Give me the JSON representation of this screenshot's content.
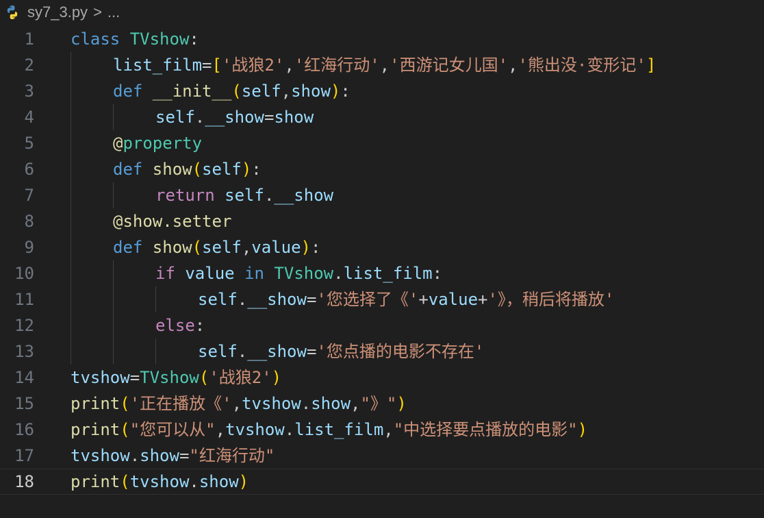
{
  "breadcrumb": {
    "file": "sy7_3.py",
    "separator": ">",
    "more": "..."
  },
  "lines": [
    {
      "n": "1",
      "indent": 0,
      "tokens": [
        {
          "t": "class ",
          "c": "kw"
        },
        {
          "t": "TVshow",
          "c": "cls"
        },
        {
          "t": ":",
          "c": "pun"
        }
      ]
    },
    {
      "n": "2",
      "indent": 1,
      "tokens": [
        {
          "t": "list_film",
          "c": "var"
        },
        {
          "t": "=",
          "c": "pun"
        },
        {
          "t": "[",
          "c": "br1"
        },
        {
          "t": "'战狼2'",
          "c": "str"
        },
        {
          "t": ",",
          "c": "pun"
        },
        {
          "t": "'红海行动'",
          "c": "str"
        },
        {
          "t": ",",
          "c": "pun"
        },
        {
          "t": "'西游记女儿国'",
          "c": "str"
        },
        {
          "t": ",",
          "c": "pun"
        },
        {
          "t": "'熊出没·变形记'",
          "c": "str"
        },
        {
          "t": "]",
          "c": "br1"
        }
      ]
    },
    {
      "n": "3",
      "indent": 1,
      "tokens": [
        {
          "t": "def ",
          "c": "kw"
        },
        {
          "t": "__init__",
          "c": "fn"
        },
        {
          "t": "(",
          "c": "br1"
        },
        {
          "t": "self",
          "c": "var"
        },
        {
          "t": ",",
          "c": "pun"
        },
        {
          "t": "show",
          "c": "var"
        },
        {
          "t": ")",
          "c": "br1"
        },
        {
          "t": ":",
          "c": "pun"
        }
      ]
    },
    {
      "n": "4",
      "indent": 2,
      "tokens": [
        {
          "t": "self",
          "c": "var"
        },
        {
          "t": ".",
          "c": "pun"
        },
        {
          "t": "__show",
          "c": "var"
        },
        {
          "t": "=",
          "c": "pun"
        },
        {
          "t": "show",
          "c": "var"
        }
      ]
    },
    {
      "n": "5",
      "indent": 1,
      "tokens": [
        {
          "t": "@",
          "c": "fn"
        },
        {
          "t": "property",
          "c": "cls"
        }
      ]
    },
    {
      "n": "6",
      "indent": 1,
      "tokens": [
        {
          "t": "def ",
          "c": "kw"
        },
        {
          "t": "show",
          "c": "fn"
        },
        {
          "t": "(",
          "c": "br1"
        },
        {
          "t": "self",
          "c": "var"
        },
        {
          "t": ")",
          "c": "br1"
        },
        {
          "t": ":",
          "c": "pun"
        }
      ]
    },
    {
      "n": "7",
      "indent": 2,
      "tokens": [
        {
          "t": "return ",
          "c": "ctl"
        },
        {
          "t": "self",
          "c": "var"
        },
        {
          "t": ".",
          "c": "pun"
        },
        {
          "t": "__show",
          "c": "var"
        }
      ]
    },
    {
      "n": "8",
      "indent": 1,
      "tokens": [
        {
          "t": "@show.setter",
          "c": "fn"
        }
      ]
    },
    {
      "n": "9",
      "indent": 1,
      "tokens": [
        {
          "t": "def ",
          "c": "kw"
        },
        {
          "t": "show",
          "c": "fn"
        },
        {
          "t": "(",
          "c": "br1"
        },
        {
          "t": "self",
          "c": "var"
        },
        {
          "t": ",",
          "c": "pun"
        },
        {
          "t": "value",
          "c": "var"
        },
        {
          "t": ")",
          "c": "br1"
        },
        {
          "t": ":",
          "c": "pun"
        }
      ]
    },
    {
      "n": "10",
      "indent": 2,
      "tokens": [
        {
          "t": "if ",
          "c": "ctl"
        },
        {
          "t": "value ",
          "c": "var"
        },
        {
          "t": "in ",
          "c": "kw"
        },
        {
          "t": "TVshow",
          "c": "cls"
        },
        {
          "t": ".",
          "c": "pun"
        },
        {
          "t": "list_film",
          "c": "var"
        },
        {
          "t": ":",
          "c": "pun"
        }
      ]
    },
    {
      "n": "11",
      "indent": 3,
      "tokens": [
        {
          "t": "self",
          "c": "var"
        },
        {
          "t": ".",
          "c": "pun"
        },
        {
          "t": "__show",
          "c": "var"
        },
        {
          "t": "=",
          "c": "pun"
        },
        {
          "t": "'您选择了《'",
          "c": "str"
        },
        {
          "t": "+",
          "c": "pun"
        },
        {
          "t": "value",
          "c": "var"
        },
        {
          "t": "+",
          "c": "pun"
        },
        {
          "t": "'》，稍后将播放'",
          "c": "str"
        }
      ]
    },
    {
      "n": "12",
      "indent": 2,
      "tokens": [
        {
          "t": "else",
          "c": "ctl"
        },
        {
          "t": ":",
          "c": "pun"
        }
      ]
    },
    {
      "n": "13",
      "indent": 3,
      "tokens": [
        {
          "t": "self",
          "c": "var"
        },
        {
          "t": ".",
          "c": "pun"
        },
        {
          "t": "__show",
          "c": "var"
        },
        {
          "t": "=",
          "c": "pun"
        },
        {
          "t": "'您点播的电影不存在'",
          "c": "str"
        }
      ]
    },
    {
      "n": "14",
      "indent": 0,
      "tokens": [
        {
          "t": "tvshow",
          "c": "var"
        },
        {
          "t": "=",
          "c": "pun"
        },
        {
          "t": "TVshow",
          "c": "cls"
        },
        {
          "t": "(",
          "c": "br1"
        },
        {
          "t": "'战狼2'",
          "c": "str"
        },
        {
          "t": ")",
          "c": "br1"
        }
      ]
    },
    {
      "n": "15",
      "indent": 0,
      "tokens": [
        {
          "t": "print",
          "c": "fn"
        },
        {
          "t": "(",
          "c": "br1"
        },
        {
          "t": "'正在播放《'",
          "c": "str"
        },
        {
          "t": ",",
          "c": "pun"
        },
        {
          "t": "tvshow",
          "c": "var"
        },
        {
          "t": ".",
          "c": "pun"
        },
        {
          "t": "show",
          "c": "var"
        },
        {
          "t": ",",
          "c": "pun"
        },
        {
          "t": "\"》\"",
          "c": "str"
        },
        {
          "t": ")",
          "c": "br1"
        }
      ]
    },
    {
      "n": "16",
      "indent": 0,
      "tokens": [
        {
          "t": "print",
          "c": "fn"
        },
        {
          "t": "(",
          "c": "br1"
        },
        {
          "t": "\"您可以从\"",
          "c": "str"
        },
        {
          "t": ",",
          "c": "pun"
        },
        {
          "t": "tvshow",
          "c": "var"
        },
        {
          "t": ".",
          "c": "pun"
        },
        {
          "t": "list_film",
          "c": "var"
        },
        {
          "t": ",",
          "c": "pun"
        },
        {
          "t": "\"中选择要点播放的电影\"",
          "c": "str"
        },
        {
          "t": ")",
          "c": "br1"
        }
      ]
    },
    {
      "n": "17",
      "indent": 0,
      "tokens": [
        {
          "t": "tvshow",
          "c": "var"
        },
        {
          "t": ".",
          "c": "pun"
        },
        {
          "t": "show",
          "c": "var"
        },
        {
          "t": "=",
          "c": "pun"
        },
        {
          "t": "\"红海行动\"",
          "c": "str"
        }
      ]
    },
    {
      "n": "18",
      "indent": 0,
      "current": true,
      "tokens": [
        {
          "t": "print",
          "c": "fn"
        },
        {
          "t": "(",
          "c": "br1"
        },
        {
          "t": "tvshow",
          "c": "var"
        },
        {
          "t": ".",
          "c": "pun"
        },
        {
          "t": "show",
          "c": "var"
        },
        {
          "t": ")",
          "c": "br1"
        }
      ]
    }
  ]
}
